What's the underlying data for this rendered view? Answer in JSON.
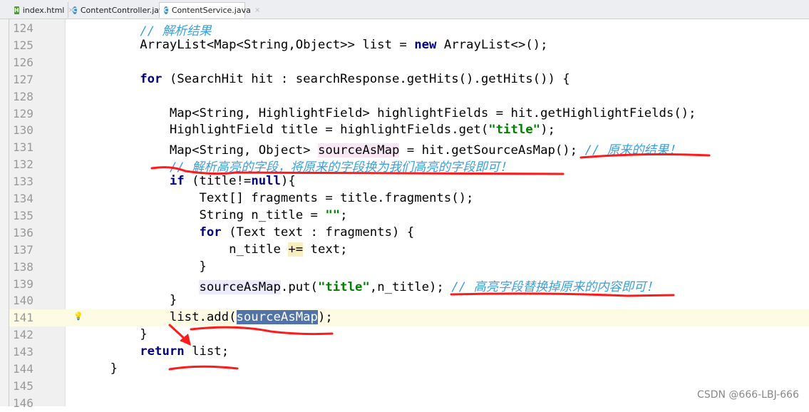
{
  "tabs": [
    {
      "label": "index.html",
      "icon": "html-file-icon"
    },
    {
      "label": "ContentController.java",
      "icon": "java-class-icon"
    },
    {
      "label": "ContentService.java",
      "icon": "java-class-icon",
      "active": true
    }
  ],
  "editor": {
    "current_line": 141,
    "lines": [
      {
        "n": "124",
        "t": [
          [
            "",
            "        "
          ],
          [
            "c",
            "// 解析结果"
          ]
        ]
      },
      {
        "n": "125",
        "t": [
          [
            "",
            "        ArrayList<Map<String,Object>> list = "
          ],
          [
            "k",
            "new"
          ],
          [
            "",
            " ArrayList<>();"
          ]
        ]
      },
      {
        "n": "126",
        "t": []
      },
      {
        "n": "127",
        "t": [
          [
            "",
            "        "
          ],
          [
            "k",
            "for"
          ],
          [
            "",
            " (SearchHit hit : searchResponse.getHits().getHits()) {"
          ]
        ]
      },
      {
        "n": "128",
        "t": []
      },
      {
        "n": "129",
        "t": [
          [
            "",
            "            Map<String, HighlightField> highlightFields = hit.getHighlightFields();"
          ]
        ]
      },
      {
        "n": "130",
        "t": [
          [
            "",
            "            HighlightField title = highlightFields.get("
          ],
          [
            "s",
            "\"title\""
          ],
          [
            "",
            ");"
          ]
        ]
      },
      {
        "n": "131",
        "t": [
          [
            "",
            "            Map<String, Object> "
          ],
          [
            "h1",
            "sourceAsMap"
          ],
          [
            "",
            " = hit.getSourceAsMap(); "
          ],
          [
            "c",
            "// 原来的结果！"
          ]
        ]
      },
      {
        "n": "132",
        "t": [
          [
            "",
            "            "
          ],
          [
            "c",
            "// 解析高亮的字段，将原来的字段换为我们高亮的字段即可！"
          ]
        ]
      },
      {
        "n": "133",
        "t": [
          [
            "",
            "            "
          ],
          [
            "k",
            "if"
          ],
          [
            "",
            " (title!="
          ],
          [
            "k",
            "null"
          ],
          [
            "",
            "){"
          ]
        ]
      },
      {
        "n": "134",
        "t": [
          [
            "",
            "                Text[] fragments = title.fragments();"
          ]
        ]
      },
      {
        "n": "135",
        "t": [
          [
            "",
            "                String n_title = "
          ],
          [
            "s",
            "\"\""
          ],
          [
            "",
            ";"
          ]
        ]
      },
      {
        "n": "136",
        "t": [
          [
            "",
            "                "
          ],
          [
            "k",
            "for"
          ],
          [
            "",
            " (Text text : fragments) {"
          ]
        ]
      },
      {
        "n": "137",
        "t": [
          [
            "",
            "                    n_title "
          ],
          [
            "y",
            "+="
          ],
          [
            "",
            " text;"
          ]
        ]
      },
      {
        "n": "138",
        "t": [
          [
            "",
            "                }"
          ]
        ]
      },
      {
        "n": "139",
        "t": [
          [
            "",
            "                "
          ],
          [
            "h2",
            "sourceAsMap"
          ],
          [
            "",
            ".put("
          ],
          [
            "s",
            "\"title\""
          ],
          [
            "",
            ",n_title); "
          ],
          [
            "c",
            "// 高亮字段替换掉原来的内容即可！"
          ]
        ]
      },
      {
        "n": "140",
        "t": [
          [
            "",
            "            }"
          ]
        ]
      },
      {
        "n": "141",
        "t": [
          [
            "",
            "            list.add("
          ],
          [
            "sel",
            "sourceAsMap"
          ],
          [
            "",
            ");"
          ]
        ]
      },
      {
        "n": "142",
        "t": [
          [
            "",
            "        }"
          ]
        ]
      },
      {
        "n": "143",
        "t": [
          [
            "",
            "        "
          ],
          [
            "k",
            "return"
          ],
          [
            "",
            " list;"
          ]
        ]
      },
      {
        "n": "144",
        "t": [
          [
            "",
            "    }"
          ]
        ]
      },
      {
        "n": "145",
        "t": []
      },
      {
        "n": "146",
        "t": []
      }
    ]
  },
  "annotation_color": "#ff1a1a",
  "watermark": "CSDN @666-LBJ-666"
}
